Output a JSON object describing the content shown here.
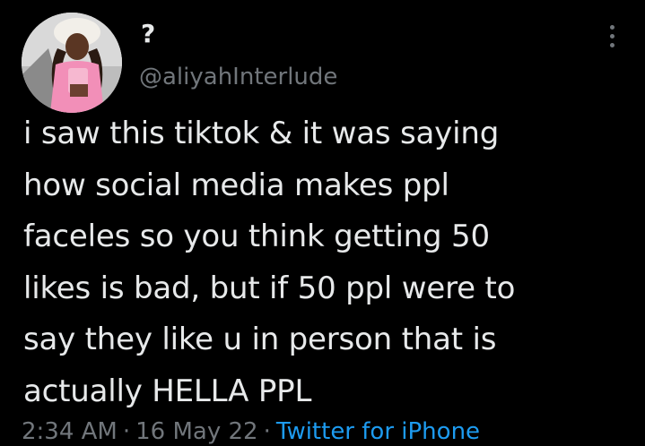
{
  "colors": {
    "background": "#000000",
    "primary_text": "#e7e9ea",
    "secondary_text": "#71767b",
    "link": "#1d9bf0"
  },
  "author": {
    "display_name": "?",
    "handle": "@aliyahInterlude",
    "avatar_icon": "user-avatar-photo"
  },
  "more_icon": "more-vertical-icon",
  "tweet": {
    "lines": [
      "i saw this tiktok & it was saying",
      "how social media makes ppl",
      "faceles so you think getting 50",
      "likes is bad, but if 50 ppl were to",
      "say they like u in person that is",
      "actually HELLA PPL"
    ]
  },
  "meta": {
    "time": "2:34 AM",
    "separator": "·",
    "date": "16 May 22",
    "source": "Twitter for iPhone"
  }
}
